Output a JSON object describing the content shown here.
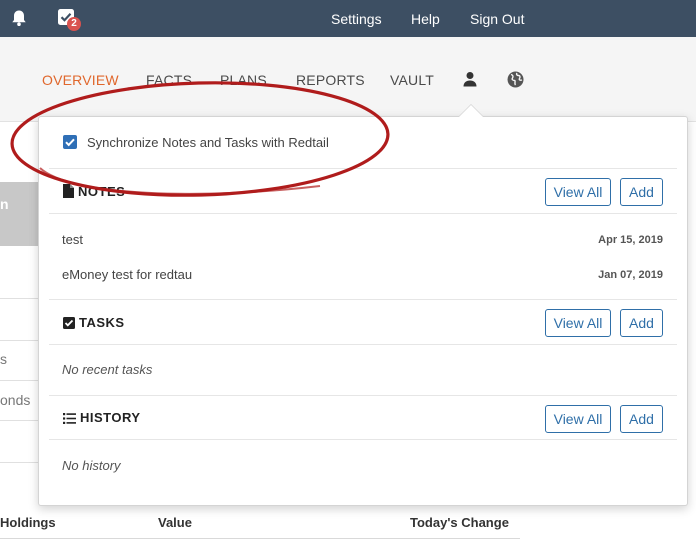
{
  "topbar": {
    "notification_count": "2",
    "links": [
      "Settings",
      "Help",
      "Sign Out"
    ]
  },
  "nav": {
    "items": [
      "OVERVIEW",
      "FACTS",
      "PLANS",
      "REPORTS",
      "VAULT"
    ],
    "active": "OVERVIEW",
    "icons": [
      "user-icon",
      "globe-icon"
    ]
  },
  "background": {
    "left_fragments": [
      "n",
      "s",
      "onds"
    ],
    "table_headers": [
      "Holdings",
      "Value",
      "Today's Change"
    ]
  },
  "panel": {
    "sync_label": "Synchronize Notes and Tasks with Redtail",
    "sync_checked": true,
    "notes": {
      "title": "NOTES",
      "view_all": "View All",
      "add": "Add",
      "items": [
        {
          "text": "test",
          "date": "Apr 15, 2019"
        },
        {
          "text": "eMoney test for redtau",
          "date": "Jan 07, 2019"
        }
      ]
    },
    "tasks": {
      "title": "TASKS",
      "view_all": "View All",
      "add": "Add",
      "empty": "No recent tasks"
    },
    "history": {
      "title": "HISTORY",
      "view_all": "View All",
      "add": "Add",
      "empty": "No history"
    }
  },
  "colors": {
    "topbar": "#3d4f63",
    "accent": "#e0672c",
    "button": "#2f6fa8",
    "annotation": "#b01c1c"
  }
}
